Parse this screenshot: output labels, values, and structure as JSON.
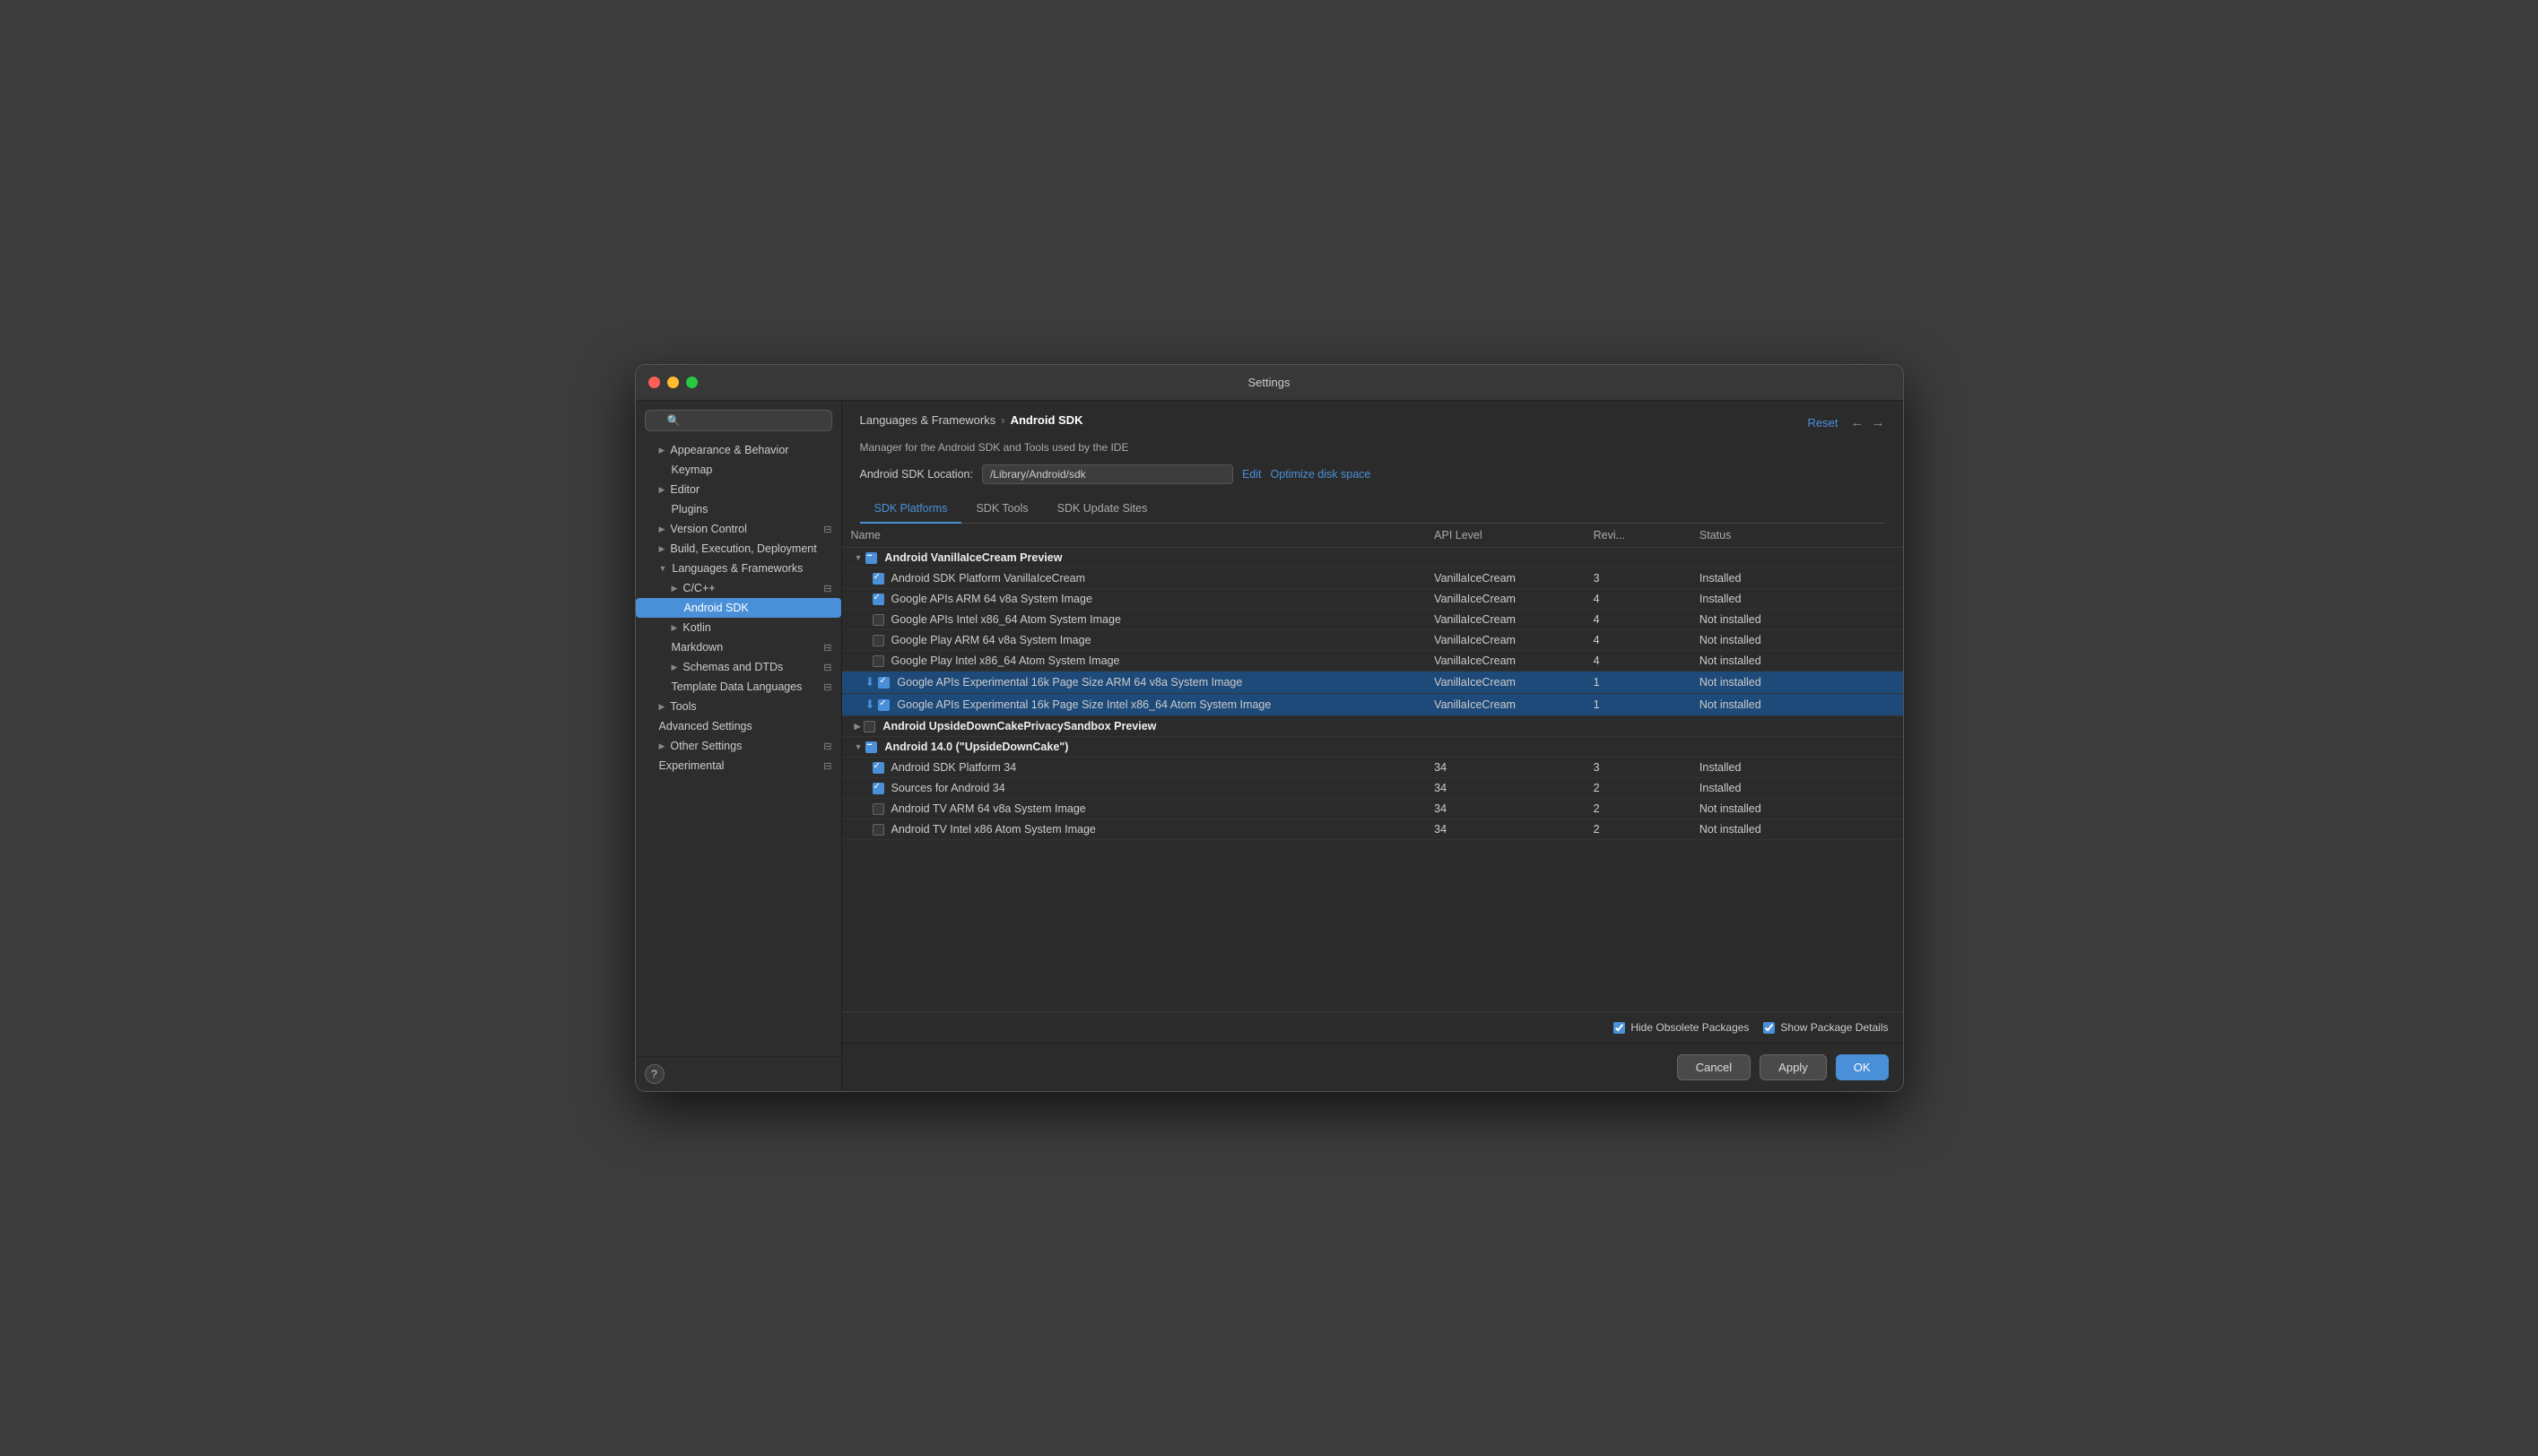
{
  "window": {
    "title": "Settings"
  },
  "sidebar": {
    "search_placeholder": "🔍",
    "items": [
      {
        "id": "appearance",
        "label": "Appearance & Behavior",
        "indent": 0,
        "hasArrow": true,
        "expanded": false
      },
      {
        "id": "keymap",
        "label": "Keymap",
        "indent": 1,
        "hasArrow": false
      },
      {
        "id": "editor",
        "label": "Editor",
        "indent": 0,
        "hasArrow": true,
        "expanded": false
      },
      {
        "id": "plugins",
        "label": "Plugins",
        "indent": 1,
        "hasArrow": false
      },
      {
        "id": "version-control",
        "label": "Version Control",
        "indent": 0,
        "hasArrow": true,
        "expanded": false
      },
      {
        "id": "build",
        "label": "Build, Execution, Deployment",
        "indent": 0,
        "hasArrow": true,
        "expanded": false
      },
      {
        "id": "languages",
        "label": "Languages & Frameworks",
        "indent": 0,
        "hasArrow": true,
        "expanded": true
      },
      {
        "id": "cpp",
        "label": "C/C++",
        "indent": 1,
        "hasArrow": true,
        "expanded": false
      },
      {
        "id": "android-sdk",
        "label": "Android SDK",
        "indent": 2,
        "active": true
      },
      {
        "id": "kotlin",
        "label": "Kotlin",
        "indent": 1,
        "hasArrow": true,
        "expanded": false
      },
      {
        "id": "markdown",
        "label": "Markdown",
        "indent": 1,
        "hasArrow": false,
        "hasPage": true
      },
      {
        "id": "schemas",
        "label": "Schemas and DTDs",
        "indent": 1,
        "hasArrow": true,
        "hasPage": true
      },
      {
        "id": "template",
        "label": "Template Data Languages",
        "indent": 1,
        "hasArrow": false,
        "hasPage": true
      },
      {
        "id": "tools",
        "label": "Tools",
        "indent": 0,
        "hasArrow": true,
        "expanded": false
      },
      {
        "id": "advanced",
        "label": "Advanced Settings",
        "indent": 0,
        "hasArrow": false
      },
      {
        "id": "other",
        "label": "Other Settings",
        "indent": 0,
        "hasArrow": true,
        "hasPage": true
      },
      {
        "id": "experimental",
        "label": "Experimental",
        "indent": 0,
        "hasArrow": false,
        "hasPage": true
      }
    ]
  },
  "breadcrumb": {
    "parent": "Languages & Frameworks",
    "separator": "›",
    "current": "Android SDK"
  },
  "header": {
    "reset_label": "Reset",
    "description": "Manager for the Android SDK and Tools used by the IDE",
    "location_label": "Android SDK Location:",
    "location_value": "/Library/Android/sdk",
    "edit_label": "Edit",
    "optimize_label": "Optimize disk space"
  },
  "tabs": [
    {
      "id": "sdk-platforms",
      "label": "SDK Platforms",
      "active": true
    },
    {
      "id": "sdk-tools",
      "label": "SDK Tools",
      "active": false
    },
    {
      "id": "sdk-update-sites",
      "label": "SDK Update Sites",
      "active": false
    }
  ],
  "table": {
    "columns": [
      {
        "id": "name",
        "label": "Name"
      },
      {
        "id": "api",
        "label": "API Level"
      },
      {
        "id": "rev",
        "label": "Revi..."
      },
      {
        "id": "status",
        "label": "Status"
      }
    ],
    "rows": [
      {
        "id": "vanilla-group",
        "type": "group",
        "expanded": true,
        "check": "mixed",
        "name": "Android VanillaIceCream Preview",
        "api": "",
        "rev": "",
        "status": "",
        "indent": 0
      },
      {
        "id": "vanilla-platform",
        "type": "item",
        "check": "checked",
        "name": "Android SDK Platform VanillaIceCream",
        "api": "VanillaIceCream",
        "rev": "3",
        "status": "Installed",
        "indent": 1
      },
      {
        "id": "vanilla-arm64",
        "type": "item",
        "check": "checked",
        "name": "Google APIs ARM 64 v8a System Image",
        "api": "VanillaIceCream",
        "rev": "4",
        "status": "Installed",
        "indent": 1
      },
      {
        "id": "vanilla-intel-x86",
        "type": "item",
        "check": "unchecked",
        "name": "Google APIs Intel x86_64 Atom System Image",
        "api": "VanillaIceCream",
        "rev": "4",
        "status": "Not installed",
        "indent": 1
      },
      {
        "id": "vanilla-play-arm",
        "type": "item",
        "check": "unchecked",
        "name": "Google Play ARM 64 v8a System Image",
        "api": "VanillaIceCream",
        "rev": "4",
        "status": "Not installed",
        "indent": 1
      },
      {
        "id": "vanilla-play-intel",
        "type": "item",
        "check": "unchecked",
        "name": "Google Play Intel x86_64 Atom System Image",
        "api": "VanillaIceCream",
        "rev": "4",
        "status": "Not installed",
        "indent": 1
      },
      {
        "id": "vanilla-exp-arm",
        "type": "item",
        "check": "checked",
        "name": "Google APIs Experimental 16k Page Size ARM 64 v8a System Image",
        "api": "VanillaIceCream",
        "rev": "1",
        "status": "Not installed",
        "indent": 1,
        "selected": true,
        "download": true
      },
      {
        "id": "vanilla-exp-intel",
        "type": "item",
        "check": "checked",
        "name": "Google APIs Experimental 16k Page Size Intel x86_64 Atom System Image",
        "api": "VanillaIceCream",
        "rev": "1",
        "status": "Not installed",
        "indent": 1,
        "selected": true,
        "download": true
      },
      {
        "id": "upsidedown-group",
        "type": "group",
        "expanded": false,
        "check": "unchecked",
        "name": "Android UpsideDownCakePrivacySandbox Preview",
        "api": "",
        "rev": "",
        "status": "",
        "indent": 0
      },
      {
        "id": "android14-group",
        "type": "group",
        "expanded": true,
        "check": "mixed",
        "name": "Android 14.0 (\"UpsideDownCake\")",
        "api": "",
        "rev": "",
        "status": "",
        "indent": 0
      },
      {
        "id": "android14-platform",
        "type": "item",
        "check": "checked",
        "name": "Android SDK Platform 34",
        "api": "34",
        "rev": "3",
        "status": "Installed",
        "indent": 1
      },
      {
        "id": "android14-sources",
        "type": "item",
        "check": "checked",
        "name": "Sources for Android 34",
        "api": "34",
        "rev": "2",
        "status": "Installed",
        "indent": 1
      },
      {
        "id": "android14-tv-arm",
        "type": "item",
        "check": "unchecked",
        "name": "Android TV ARM 64 v8a System Image",
        "api": "34",
        "rev": "2",
        "status": "Not installed",
        "indent": 1
      },
      {
        "id": "android14-tv-intel",
        "type": "item",
        "check": "unchecked",
        "name": "Android TV Intel x86 Atom System Image",
        "api": "34",
        "rev": "2",
        "status": "Not installed",
        "indent": 1
      }
    ]
  },
  "bottom_options": {
    "hide_obsolete": {
      "label": "Hide Obsolete Packages",
      "checked": true
    },
    "show_package": {
      "label": "Show Package Details",
      "checked": true
    }
  },
  "footer": {
    "cancel_label": "Cancel",
    "apply_label": "Apply",
    "ok_label": "OK"
  }
}
